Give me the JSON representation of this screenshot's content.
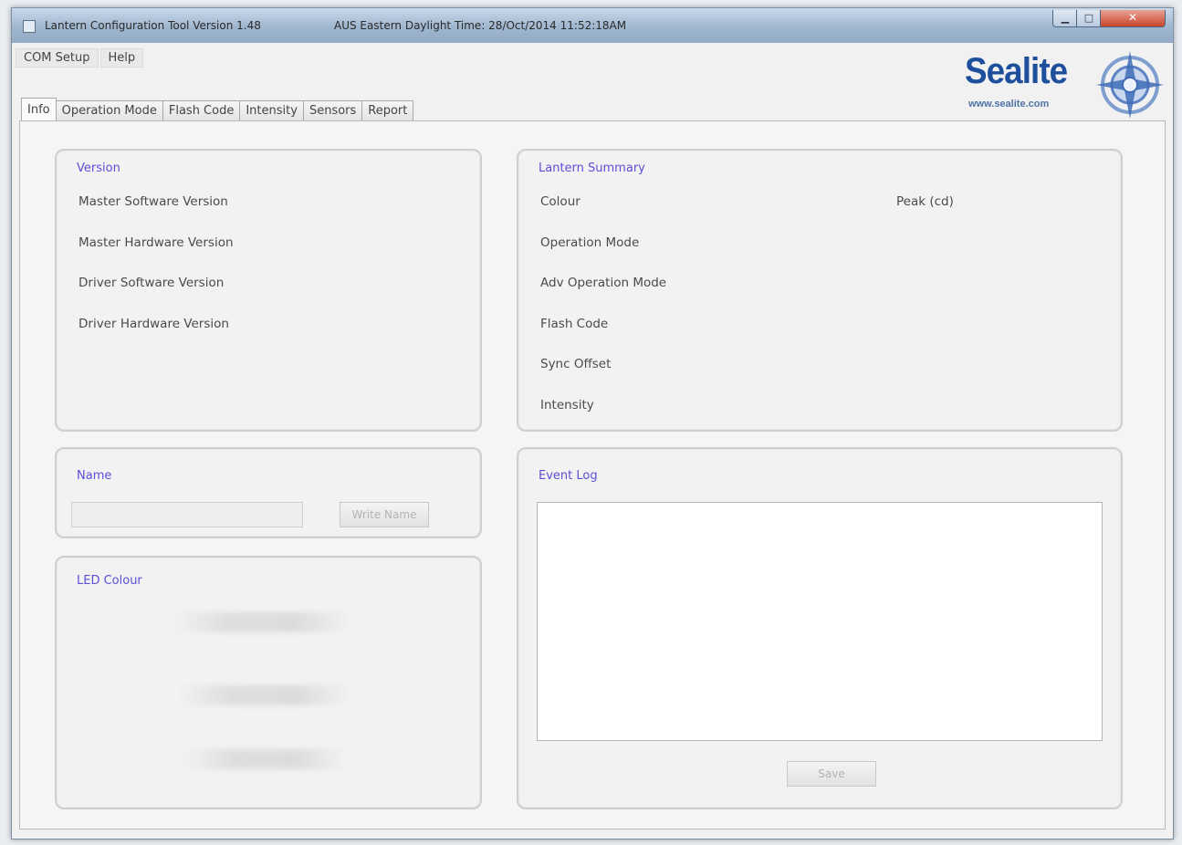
{
  "window": {
    "title": "Lantern Configuration Tool Version 1.48",
    "timestamp": "AUS Eastern Daylight Time: 28/Oct/2014 11:52:18AM"
  },
  "menu": [
    "COM Setup",
    "Help"
  ],
  "logo": {
    "brand": "Sealite",
    "url": "www.sealite.com"
  },
  "tabs": [
    {
      "label": "Info",
      "active": true
    },
    {
      "label": "Operation Mode"
    },
    {
      "label": "Flash Code"
    },
    {
      "label": "Intensity"
    },
    {
      "label": "Sensors"
    },
    {
      "label": "Report"
    }
  ],
  "version": {
    "title": "Version",
    "rows": [
      "Master Software Version",
      "Master Hardware Version",
      "Driver Software Version",
      "Driver Hardware Version"
    ]
  },
  "lantern_summary": {
    "title": "Lantern Summary",
    "rows": [
      "Colour",
      "Operation Mode",
      "Adv Operation Mode",
      "Flash Code",
      "Sync Offset",
      "Intensity"
    ],
    "peak_label": "Peak (cd)"
  },
  "name": {
    "title": "Name",
    "input_value": "",
    "write_button": "Write Name"
  },
  "led_colour": {
    "title": "LED Colour"
  },
  "event_log": {
    "title": "Event Log",
    "content": "",
    "save_button": "Save"
  },
  "colors": {
    "group_title": "#5b4fd8",
    "brand": "#1d4f9c",
    "close_button": "#c9452c"
  }
}
